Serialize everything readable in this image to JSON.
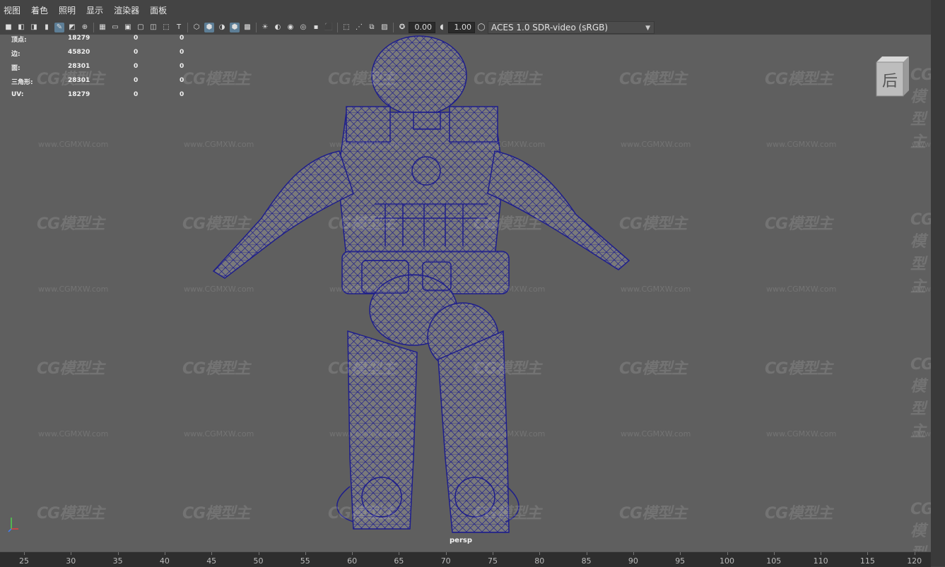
{
  "menu": [
    "视图",
    "着色",
    "照明",
    "显示",
    "渲染器",
    "面板"
  ],
  "toolbar": {
    "exposure": "0.00",
    "gamma": "1.00",
    "color_space": "ACES 1.0 SDR-video (sRGB)",
    "icons": [
      "camera-icon",
      "camera-lock-icon",
      "camera-attributes-icon",
      "bookmark-icon",
      "grease-pencil-icon",
      "image-plane-icon",
      "2d-pan-zoom-icon",
      "grid-icon",
      "film-gate-icon",
      "resolution-gate-icon",
      "gate-mask-icon",
      "field-chart-icon",
      "safe-action-icon",
      "safe-title-icon",
      "wireframe-icon",
      "smooth-shade-icon",
      "default-material-icon",
      "wireframe-on-shaded-icon",
      "xray-icon",
      "use-lights-icon",
      "shadows-icon",
      "screen-space-ao-icon",
      "motion-blur-icon",
      "anti-aliasing-icon",
      "depth-of-field-icon",
      "isolate-select-icon",
      "xray-joints-icon",
      "xray-active-icon",
      "backface-cull-icon",
      "exposure-icon",
      "gamma-icon",
      "color-management-icon"
    ],
    "accent": "#5d7e96"
  },
  "hud": {
    "rows": [
      {
        "label": "顶点:",
        "v1": "18279",
        "v2": "0",
        "v3": "0"
      },
      {
        "label": "边:",
        "v1": "45820",
        "v2": "0",
        "v3": "0"
      },
      {
        "label": "面:",
        "v1": "28301",
        "v2": "0",
        "v3": "0"
      },
      {
        "label": "三角形:",
        "v1": "28301",
        "v2": "0",
        "v3": "0"
      },
      {
        "label": "UV:",
        "v1": "18279",
        "v2": "0",
        "v3": "0"
      }
    ]
  },
  "viewcube_label": "后",
  "camera_label": "persp",
  "watermark": {
    "logo": "CG模型主",
    "url": "www.CGMXW.com"
  },
  "timeline": {
    "ticks": [
      "25",
      "30",
      "35",
      "40",
      "45",
      "50",
      "55",
      "60",
      "65",
      "70",
      "75",
      "80",
      "85",
      "90",
      "95",
      "100",
      "105",
      "110",
      "115",
      "120"
    ]
  },
  "wire_color": "#1e1e8c",
  "model_color": "#7d7d7d"
}
